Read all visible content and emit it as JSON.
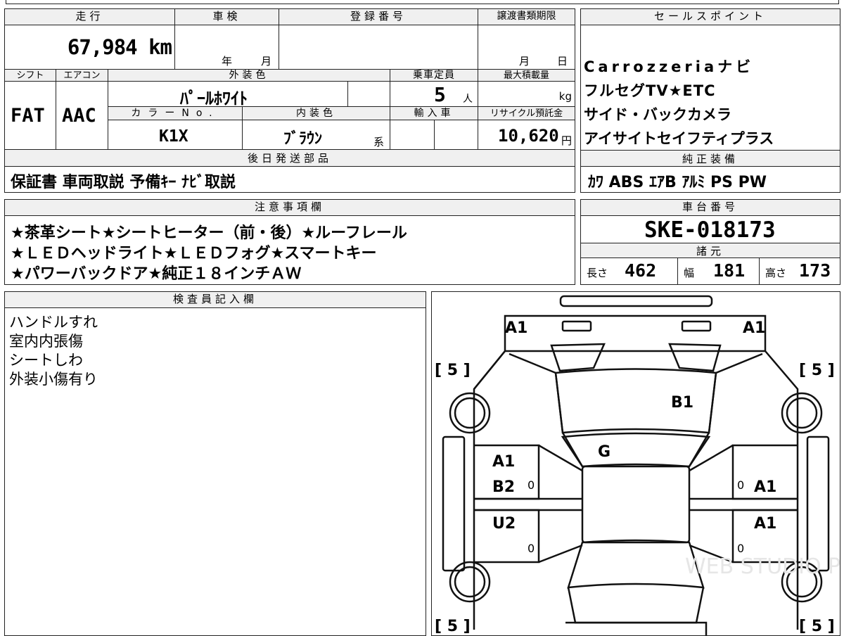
{
  "headers": {
    "mileage": "走行",
    "inspection": "車検",
    "registration": "登録番号",
    "transfer_deadline": "譲渡書類期限",
    "sales_points": "セールスポイント",
    "shift": "シフト",
    "aircon": "エアコン",
    "exterior_color": "外装色",
    "capacity": "乗車定員",
    "max_load": "最大積載量",
    "color_no": "カラーNo.",
    "interior_color": "内装色",
    "import": "輸入車",
    "recycle_fee": "リサイクル預託金",
    "later_parts": "後日発送部品",
    "genuine_equipment": "純正装備",
    "notes": "注意事項欄",
    "chassis_no": "車台番号",
    "specs": "諸元",
    "inspector": "検査員記入欄"
  },
  "vehicle": {
    "mileage": "67,984 km",
    "inspection_year": "年",
    "inspection_month": "月",
    "deadline_month": "月",
    "deadline_day": "日",
    "shift": "FAT",
    "aircon": "AAC",
    "exterior_color": "ﾊﾟｰﾙﾎﾜｲﾄ",
    "capacity": "5",
    "capacity_unit": "人",
    "load_unit": "kg",
    "color_no": "K1X",
    "interior_color": "ﾌﾞﾗｳﾝ",
    "interior_suffix": "系",
    "recycle_fee": "10,620",
    "recycle_unit": "円",
    "later_parts": "保証書 車両取説 予備ｷｰ ﾅﾋﾞ取説",
    "chassis_no": "SKE-018173"
  },
  "sales_points": [
    "Carrozzeriaナビ",
    "フルセグTV★ETC",
    "サイド・バックカメラ",
    "アイサイトセイフティプラス"
  ],
  "equipment": "ｶﾜ ABS ｴｱB ｱﾙﾐ PS PW",
  "notes": [
    "★茶革シート★シートヒーター（前・後）★ルーフレール",
    "★ＬＥＤヘッドライト★ＬＥＤフォグ★スマートキー",
    "★パワーバックドア★純正１８インチＡＷ"
  ],
  "specs": {
    "length_label": "長さ",
    "length": "462",
    "width_label": "幅",
    "width": "181",
    "height_label": "高さ",
    "height": "173"
  },
  "inspector_notes": [
    "ハンドルすれ",
    "室内内張傷",
    "シートしわ",
    "外装小傷有り"
  ],
  "diagram": {
    "marks": {
      "a1_front_left": "A1",
      "a1_front_right": "A1",
      "b1_hood": "B1",
      "g_windshield": "G",
      "a1_left_front_door": "A1",
      "b2_left_front_door": "B2",
      "u2_left_rear_door": "U2",
      "a1_right_front_door": "A1",
      "a1_right_rear_door": "A1"
    },
    "tire_label": "[ 5 ]",
    "zero": "0",
    "watermark": "WEB STUDIO PLUS"
  }
}
